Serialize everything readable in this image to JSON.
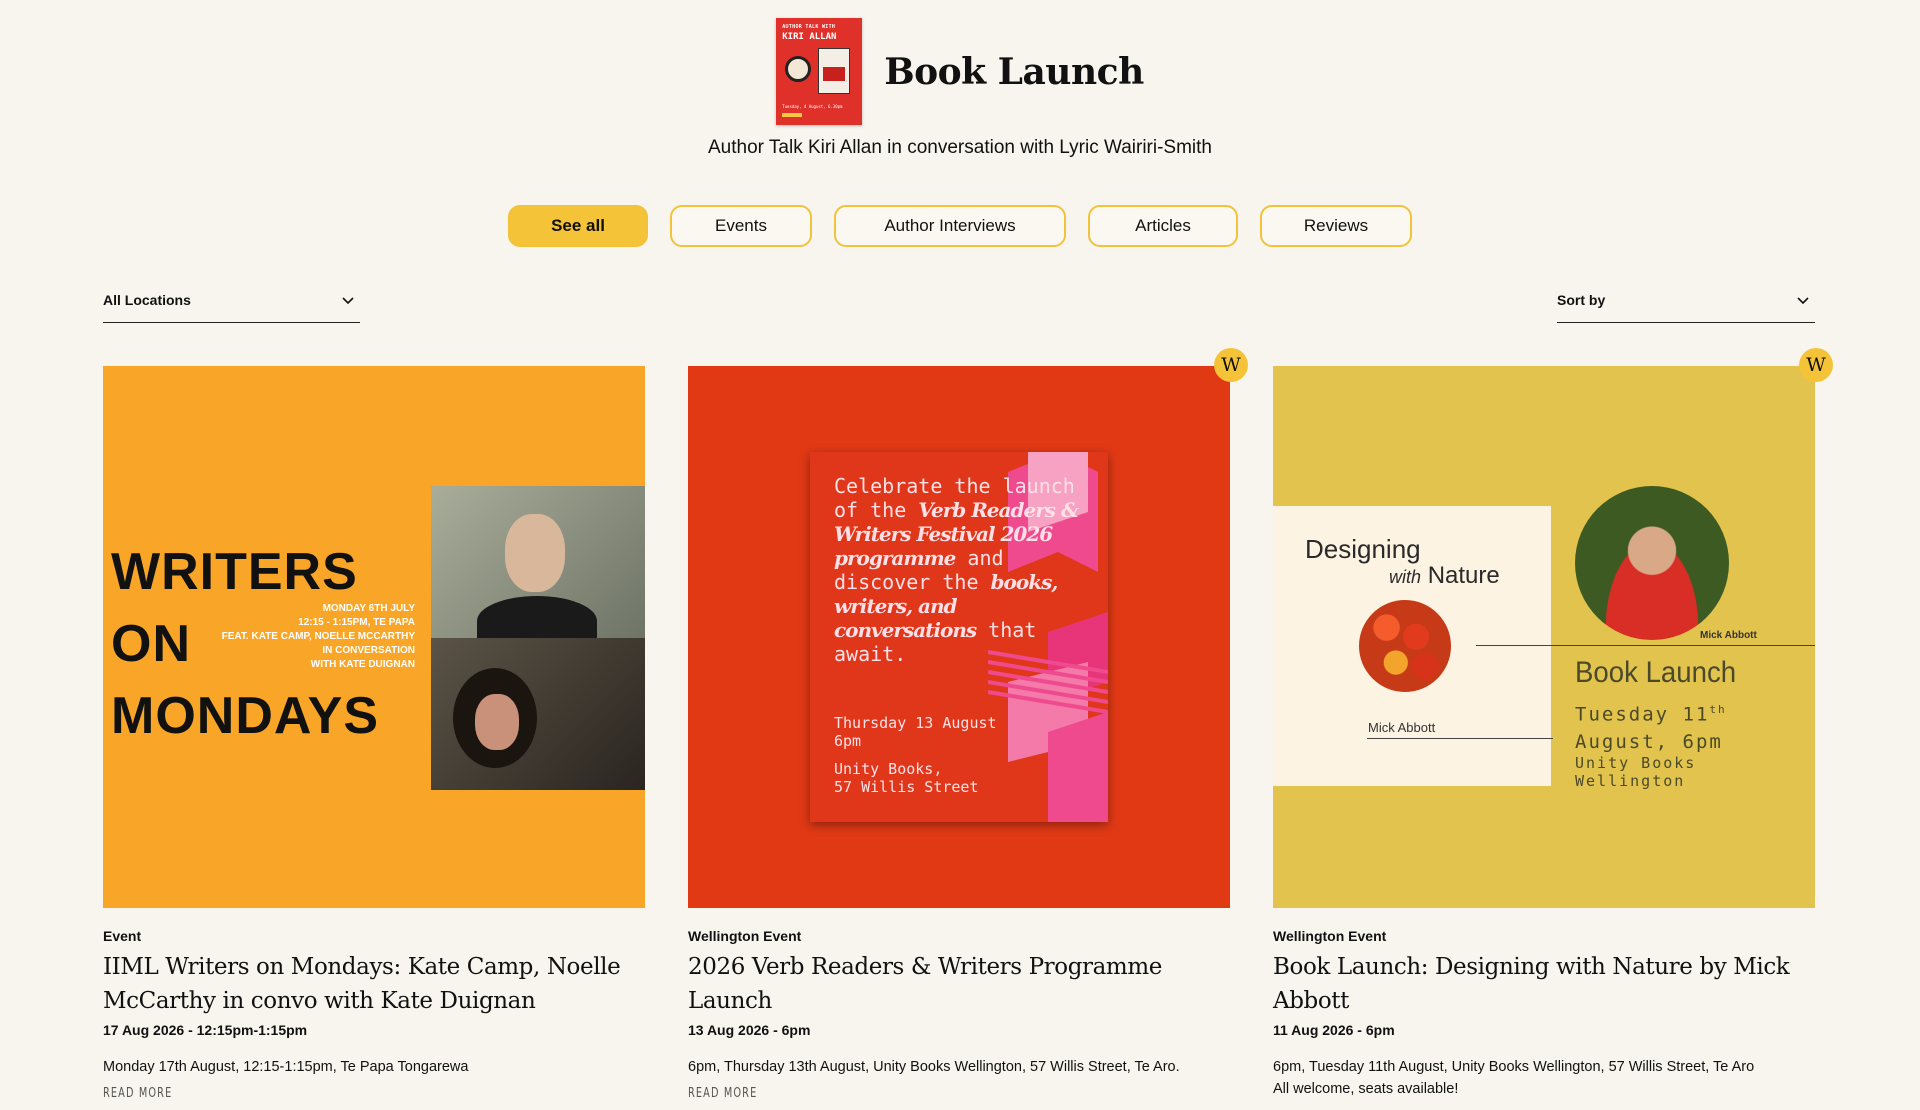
{
  "header": {
    "title": "Book Launch",
    "subtitle": "Author Talk Kiri Allan in conversation with Lyric Wairiri-Smith",
    "thumb": {
      "line1": "AUTHOR TALK WITH",
      "line2": "KIRI ALLAN",
      "footer": "Tuesday, 4 August, 6.30pm"
    }
  },
  "filters": [
    {
      "label": "See all",
      "active": true
    },
    {
      "label": "Events",
      "active": false
    },
    {
      "label": "Author Interviews",
      "active": false
    },
    {
      "label": "Articles",
      "active": false
    },
    {
      "label": "Reviews",
      "active": false
    }
  ],
  "location_dropdown": {
    "label": "All Locations"
  },
  "sort_dropdown": {
    "label": "Sort by"
  },
  "cards": [
    {
      "category": "Event",
      "title": "IIML Writers on Mondays: Kate Camp, Noelle McCarthy in convo with Kate Duignan",
      "date": "17 Aug 2026 - 12:15pm-1:15pm",
      "description": "Monday 17th August, 12:15-1:15pm, Te Papa Tongarewa",
      "read_more": "READ MORE",
      "has_badge": false,
      "art": {
        "headline": "WRITERS ON MONDAYS",
        "info": "MONDAY 6TH JULY\n12:15 - 1:15PM, TE PAPA\nFEAT. KATE CAMP, NOELLE MCCARTHY\nIN CONVERSATION\nWITH KATE DUIGNAN"
      }
    },
    {
      "category": "Wellington Event",
      "title": "2026 Verb Readers & Writers Programme Launch",
      "date": "13 Aug 2026 - 6pm",
      "description": "6pm, Thursday 13th August, Unity Books Wellington, 57 Willis Street, Te Aro.",
      "read_more": "READ MORE",
      "has_badge": true,
      "badge": "W",
      "art": {
        "text_a": "Celebrate the launch of the ",
        "text_b": "Verb Readers & Writers Festival 2026 programme",
        "text_c": " and discover the ",
        "text_d": "books, writers, and conversations",
        "text_e": " that await.",
        "date_line1": "Thursday 13 August",
        "date_line2": "6pm",
        "addr_line1": "Unity Books,",
        "addr_line2": "57 Willis Street"
      }
    },
    {
      "category": "Wellington Event",
      "title": "Book Launch: Designing with Nature by Mick Abbott",
      "date": "11 Aug 2026 - 6pm",
      "description": "6pm, Tuesday 11th August, Unity Books Wellington, 57 Willis Street, Te Aro\nAll welcome, seats available!",
      "read_more": "",
      "has_badge": true,
      "badge": "W",
      "art": {
        "book_title_1": "Designing",
        "book_title_with": "with",
        "book_title_2": "Nature",
        "author_small": "Mick Abbott",
        "author_tag": "Mick Abbott",
        "headline": "Book Launch",
        "date_1": "Tuesday 11",
        "date_sup": "th",
        "date_2": "August, 6pm",
        "venue": "Unity Books Wellington"
      }
    }
  ],
  "colors": {
    "background": "#f8f5ef",
    "accent": "#f4c338",
    "card0": "#f9a628",
    "card1": "#e23915",
    "card2": "#e2c34d"
  }
}
